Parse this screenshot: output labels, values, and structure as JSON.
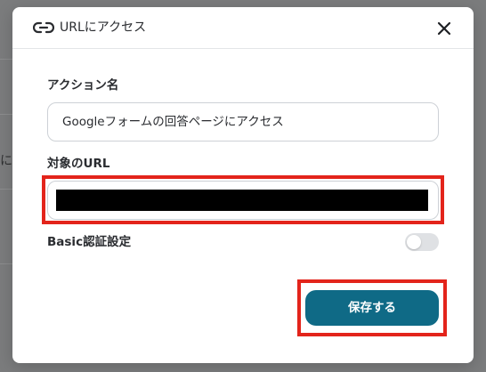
{
  "background": {
    "partial_text": "にア"
  },
  "dialog": {
    "title": "URLにアクセス",
    "icon": "link-icon",
    "close_icon": "close-icon"
  },
  "action_name": {
    "label": "アクション名",
    "value": "Googleフォームの回答ページにアクセス"
  },
  "target_url": {
    "label": "対象のURL",
    "value_redacted": true
  },
  "basic_auth": {
    "label": "Basic認証設定",
    "enabled": false
  },
  "save_button": {
    "label": "保存する"
  },
  "colors": {
    "accent": "#0f6a86",
    "highlight": "#e3241b"
  }
}
